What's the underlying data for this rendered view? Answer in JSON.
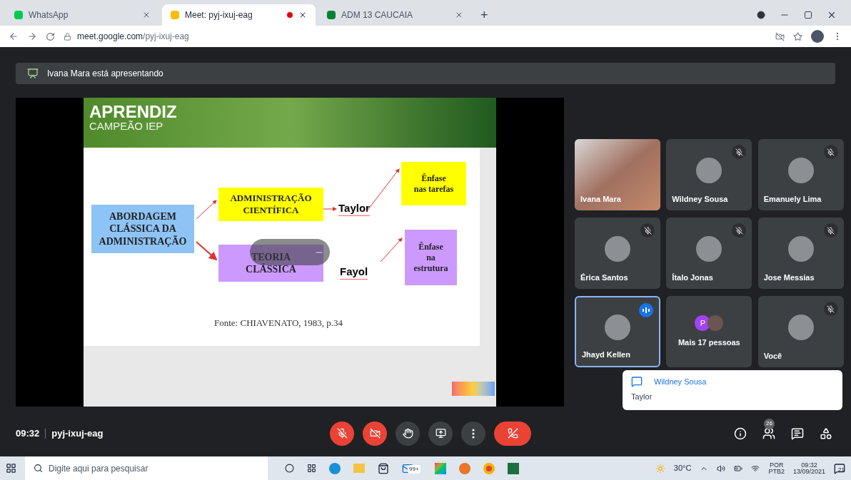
{
  "browser": {
    "tabs": [
      {
        "title": "WhatsApp",
        "selected": false,
        "recording": false
      },
      {
        "title": "Meet: pyj-ixuj-eag",
        "selected": true,
        "recording": true
      },
      {
        "title": "ADM 13 CAUCAIA",
        "selected": false,
        "recording": false
      }
    ],
    "new_tab": "+",
    "address": {
      "host": "meet.google.com",
      "path": "/pyj-ixuj-eag"
    }
  },
  "banner": {
    "text": "Ivana Mara está apresentando"
  },
  "slide": {
    "logo": "APRENDIZ",
    "logo_sub": "CAMPEÃO IEP",
    "nodes": [
      {
        "kind": "box",
        "text": "ABORDAGEM\nCLÁSSICA DA\nADMINISTRAÇÃO",
        "color": "#8ec3f5"
      },
      {
        "kind": "box",
        "text": "ADMINISTRAÇÃO\nCIENTÍFICA",
        "color": "#ffff00"
      },
      {
        "kind": "label",
        "text": "Taylor"
      },
      {
        "kind": "box",
        "text": "Ênfase\nnas tarefas",
        "color": "#ffff00"
      },
      {
        "kind": "box",
        "text": "TEORIA\nCLÁSSICA",
        "color": "#cc99ff"
      },
      {
        "kind": "label",
        "text": "Fayol"
      },
      {
        "kind": "box",
        "text": "Ênfase\nna\nestrutura",
        "color": "#cc99ff"
      }
    ],
    "source": "Fonte: CHIAVENATO, 1983, p.34"
  },
  "tiles": [
    {
      "name": "Ivana Mara",
      "kind": "video",
      "muted": false,
      "speaking": false
    },
    {
      "name": "Wildney Sousa",
      "kind": "avatar",
      "muted": true,
      "speaking": false
    },
    {
      "name": "Emanuely Lima",
      "kind": "avatar",
      "muted": true,
      "speaking": false
    },
    {
      "name": "Érica Santos",
      "kind": "avatar",
      "muted": true,
      "speaking": false
    },
    {
      "name": "Ítalo Jonas",
      "kind": "avatar",
      "muted": true,
      "speaking": false
    },
    {
      "name": "Jose Messias",
      "kind": "avatar",
      "muted": true,
      "speaking": false
    },
    {
      "name": "Jhayd Kellen",
      "kind": "avatar",
      "muted": false,
      "speaking": true
    },
    {
      "name": "Mais 17 pessoas",
      "kind": "group",
      "initial": "P",
      "muted": false,
      "speaking": false
    },
    {
      "name": "Você",
      "kind": "avatar",
      "muted": true,
      "speaking": false
    }
  ],
  "chat_toast": {
    "sender": "Wildney Sousa",
    "message": "Taylor"
  },
  "meeting": {
    "time": "09:32",
    "code": "pyj-ixuj-eag",
    "people_count": "26"
  },
  "controls": {
    "mic_off": true,
    "camera_off": true
  },
  "taskbar": {
    "search_placeholder": "Digite aqui para pesquisar",
    "mail_badge": "99+",
    "temperature": "30°C",
    "language": "POR",
    "layout": "PTB2",
    "time": "09:32",
    "date": "13/09/2021",
    "notifications": "21"
  }
}
